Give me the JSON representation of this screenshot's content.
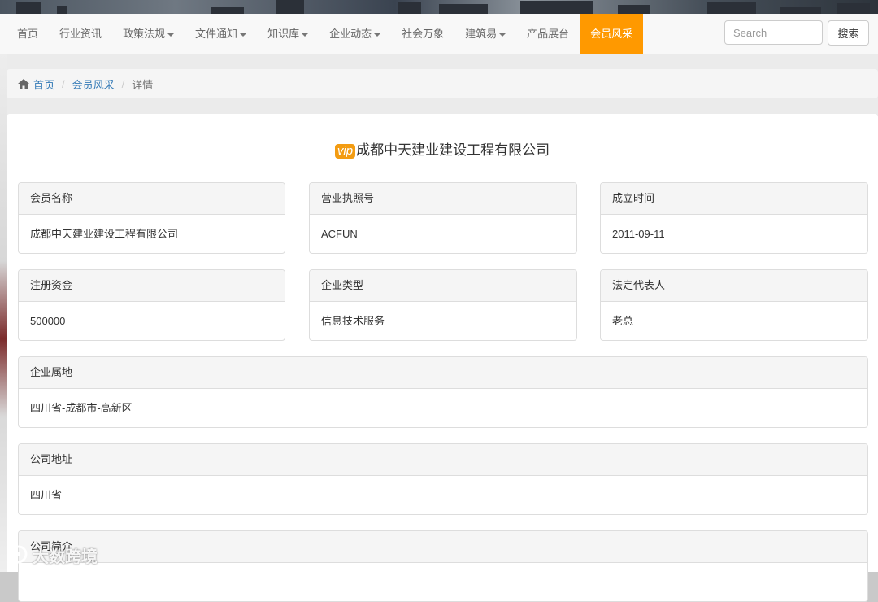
{
  "nav": {
    "items": [
      {
        "label": "首页",
        "dropdown": false,
        "active": false
      },
      {
        "label": "行业资讯",
        "dropdown": false,
        "active": false
      },
      {
        "label": "政策法规",
        "dropdown": true,
        "active": false
      },
      {
        "label": "文件通知",
        "dropdown": true,
        "active": false
      },
      {
        "label": "知识库",
        "dropdown": true,
        "active": false
      },
      {
        "label": "企业动态",
        "dropdown": true,
        "active": false
      },
      {
        "label": "社会万象",
        "dropdown": false,
        "active": false
      },
      {
        "label": "建筑易",
        "dropdown": true,
        "active": false
      },
      {
        "label": "产品展台",
        "dropdown": false,
        "active": false
      },
      {
        "label": "会员风采",
        "dropdown": false,
        "active": true
      }
    ],
    "search_placeholder": "Search",
    "search_button": "搜索",
    "active_color": "#ff9900"
  },
  "breadcrumb": {
    "home": "首页",
    "section": "会员风采",
    "current": "详情"
  },
  "detail": {
    "vip_badge": "vip",
    "company_title": "成都中天建业建设工程有限公司",
    "fields": {
      "member_name": {
        "label": "会员名称",
        "value": "成都中天建业建设工程有限公司"
      },
      "license": {
        "label": "营业执照号",
        "value": "ACFUN"
      },
      "founded": {
        "label": "成立时间",
        "value": "2011-09-11"
      },
      "capital": {
        "label": "注册资金",
        "value": "500000"
      },
      "type": {
        "label": "企业类型",
        "value": "信息技术服务"
      },
      "legal_rep": {
        "label": "法定代表人",
        "value": "老总"
      },
      "location": {
        "label": "企业属地",
        "value": "四川省-成都市-高新区"
      },
      "address": {
        "label": "公司地址",
        "value": "四川省"
      },
      "intro": {
        "label": "公司简介",
        "value": ""
      }
    }
  },
  "watermark": {
    "text": "大数跨境"
  },
  "colors": {
    "vip": "#f39c12",
    "link": "#337ab7"
  }
}
